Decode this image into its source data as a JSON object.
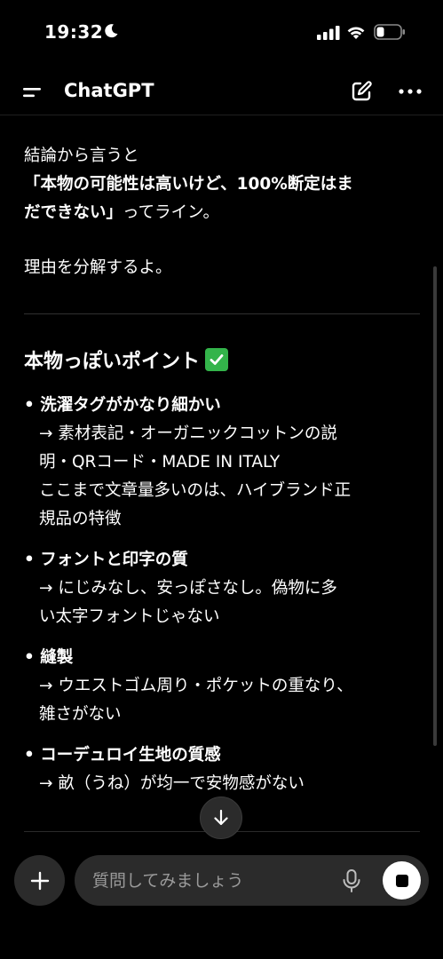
{
  "status_bar": {
    "time": "19:32"
  },
  "header": {
    "title": "ChatGPT"
  },
  "message": {
    "intro_line": "結論から言うと",
    "conclusion_line1": "「本物の可能性は高いけど、100%断定はま",
    "conclusion_line2": "だできない」",
    "conclusion_tail": "ってライン。",
    "reason_line": "理由を分解するよ。",
    "section_heading": "本物っぽいポイント",
    "points": [
      {
        "title": "• 洗濯タグがかなり細かい",
        "details": [
          "→ 素材表記・オーガニックコットンの説",
          "明・QRコード・MADE IN ITALY",
          "ここまで文章量多いのは、ハイブランド正",
          "規品の特徴"
        ]
      },
      {
        "title": "• フォントと印字の質",
        "details": [
          "→ にじみなし、安っぽさなし。偽物に多",
          "い太字フォントじゃない"
        ]
      },
      {
        "title": "• 縫製",
        "details": [
          "→ ウエストゴム周り・ポケットの重なり、",
          "雑さがない"
        ]
      },
      {
        "title": "• コーデュロイ生地の質感",
        "details": [
          "→ 畝（うね）が均一で安物感がない"
        ]
      }
    ]
  },
  "composer": {
    "placeholder": "質問してみましょう"
  },
  "colors": {
    "background": "#000000",
    "check_green": "#33b44a",
    "control_gray": "#2b2b2b"
  },
  "icons": [
    "moon-icon",
    "signal-icon",
    "wifi-icon",
    "battery-icon",
    "menu-icon",
    "new-chat-icon",
    "more-icon",
    "check-icon",
    "arrow-down-icon",
    "plus-icon",
    "mic-icon",
    "stop-icon"
  ]
}
